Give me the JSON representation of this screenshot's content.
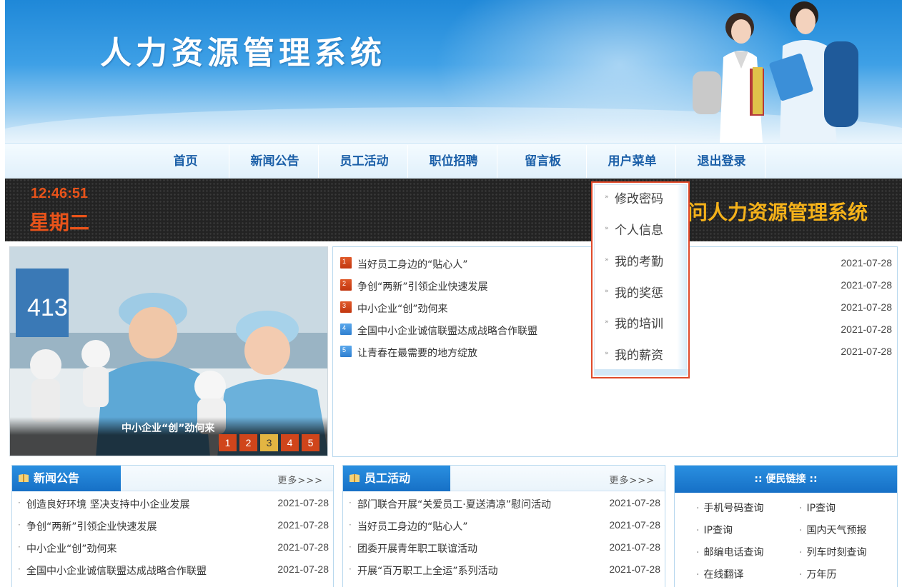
{
  "header": {
    "title": "人力资源管理系统"
  },
  "nav": [
    "首页",
    "新闻公告",
    "员工活动",
    "职位招聘",
    "留言板",
    "用户菜单",
    "退出登录"
  ],
  "bar": {
    "time": "12:46:51",
    "weekday": "星期二",
    "welcome": "欢迎访问人力资源管理系统"
  },
  "slideshow": {
    "image_number": "413",
    "caption": "中小企业“创”劲何来",
    "pages": [
      "1",
      "2",
      "3",
      "4",
      "5"
    ],
    "active": "3"
  },
  "top_news": [
    {
      "num": "1",
      "title": "当好员工身边的“贴心人”",
      "date": "2021-07-28"
    },
    {
      "num": "2",
      "title": "争创“两新”引领企业快速发展",
      "date": "2021-07-28"
    },
    {
      "num": "3",
      "title": "中小企业“创”劲何来",
      "date": "2021-07-28"
    },
    {
      "num": "4",
      "title": "全国中小企业诚信联盟达成战略合作联盟",
      "date": "2021-07-28"
    },
    {
      "num": "5",
      "title": "让青春在最需要的地方绽放",
      "date": "2021-07-28"
    }
  ],
  "user_menu": [
    "修改密码",
    "个人信息",
    "我的考勤",
    "我的奖惩",
    "我的培训",
    "我的薪资"
  ],
  "news_panel": {
    "title": "新闻公告",
    "more": "更多>>>",
    "items": [
      {
        "title": "创造良好环境 坚决支持中小企业发展",
        "date": "2021-07-28"
      },
      {
        "title": "争创“两新”引领企业快速发展",
        "date": "2021-07-28"
      },
      {
        "title": "中小企业“创”劲何来",
        "date": "2021-07-28"
      },
      {
        "title": "全国中小企业诚信联盟达成战略合作联盟",
        "date": "2021-07-28"
      }
    ]
  },
  "activity_panel": {
    "title": "员工活动",
    "more": "更多>>>",
    "items": [
      {
        "title": "部门联合开展“关爱员工·夏送清凉”慰问活动",
        "date": "2021-07-28"
      },
      {
        "title": "当好员工身边的“贴心人”",
        "date": "2021-07-28"
      },
      {
        "title": "团委开展青年职工联谊活动",
        "date": "2021-07-28"
      },
      {
        "title": "开展“百万职工上全运”系列活动",
        "date": "2021-07-28"
      }
    ]
  },
  "links_panel": {
    "title": ":: 便民链接 ::",
    "items": [
      "手机号码查询",
      "IP查询",
      "IP查询",
      "国内天气预报",
      "邮编电话查询",
      "列车时刻查询",
      "在线翻译",
      "万年历"
    ]
  },
  "colors": {
    "brand_blue": "#1670c6",
    "accent_orange": "#e8531a",
    "welcome_gold": "#f5b21a",
    "menu_border": "#e04a2a"
  }
}
